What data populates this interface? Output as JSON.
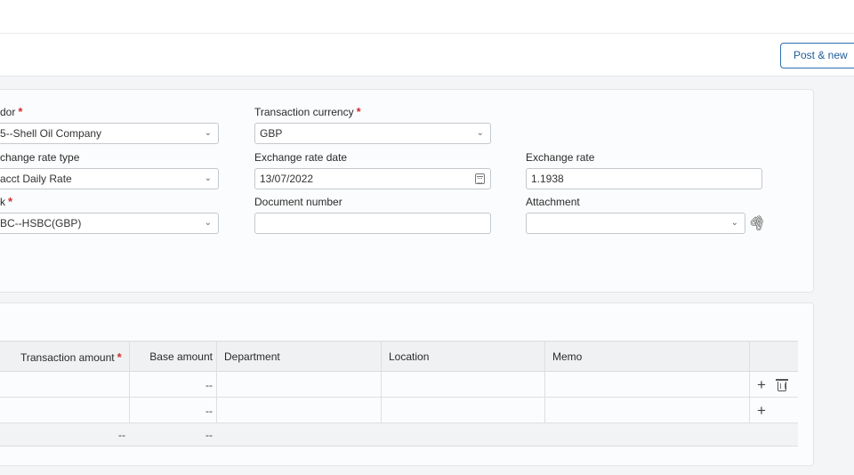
{
  "toolbar": {
    "post_new_label": "Post & new"
  },
  "header": {
    "vendor": {
      "label": "dor",
      "value": "5--Shell Oil Company",
      "required": "*"
    },
    "transaction_currency": {
      "label": "Transaction currency",
      "value": "GBP",
      "required": "*"
    },
    "exchange_rate_type": {
      "label": "change rate type",
      "value": "acct Daily Rate"
    },
    "exchange_rate_date": {
      "label": "Exchange rate date",
      "value": "13/07/2022"
    },
    "exchange_rate": {
      "label": "Exchange rate",
      "value": "1.1938"
    },
    "bank": {
      "label": "k",
      "value": "BC--HSBC(GBP)",
      "required": "*"
    },
    "document_number": {
      "label": "Document number",
      "value": ""
    },
    "attachment": {
      "label": "Attachment",
      "value": ""
    }
  },
  "lines": {
    "columns": {
      "transaction_amount": "Transaction amount",
      "transaction_amount_required": "*",
      "base_amount": "Base amount",
      "department": "Department",
      "location": "Location",
      "memo": "Memo"
    },
    "rows": [
      {
        "base_amount": "--"
      },
      {
        "base_amount": "--"
      }
    ],
    "totals": {
      "transaction_amount": "--",
      "base_amount": "--"
    }
  },
  "icons": {
    "add": "+",
    "chevron": "⌄",
    "paperclip": "🖇"
  }
}
